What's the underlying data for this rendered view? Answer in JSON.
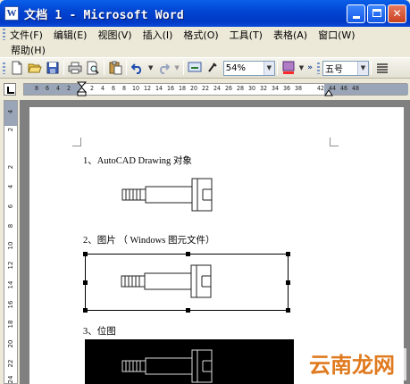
{
  "window": {
    "title": "文档 1 - Microsoft Word",
    "app_icon": "W",
    "controls": [
      "minimize-icon",
      "maximize-icon",
      "close-icon"
    ]
  },
  "menu": {
    "row1": [
      "文件(F)",
      "编辑(E)",
      "视图(V)",
      "插入(I)",
      "格式(O)",
      "工具(T)",
      "表格(A)",
      "窗口(W)"
    ],
    "row2": [
      "帮助(H)"
    ]
  },
  "toolbar": {
    "zoom": "54%",
    "font_size": "五号",
    "icons": [
      "new-icon",
      "open-icon",
      "save-icon",
      "print-icon",
      "print-preview-icon",
      "paste-icon",
      "undo-icon",
      "redo-icon",
      "insert-hyperlink-icon",
      "format-painter-icon",
      "highlight-icon",
      "align-icon"
    ]
  },
  "ruler": {
    "ticks": [
      "8",
      "6",
      "4",
      "2",
      "2",
      "4",
      "6",
      "8",
      "10",
      "12",
      "14",
      "16",
      "18",
      "20",
      "22",
      "24",
      "26",
      "28",
      "30",
      "32",
      "34",
      "36",
      "38",
      "42",
      "44",
      "46",
      "48"
    ],
    "vticks": [
      "4",
      "2",
      "2",
      "4",
      "6",
      "8",
      "10",
      "12",
      "14",
      "16",
      "18",
      "20",
      "22",
      "24"
    ]
  },
  "document": {
    "items": [
      {
        "label": "1、AutoCAD Drawing 对象"
      },
      {
        "label": "2、图片 （ Windows 图元文件）"
      },
      {
        "label": "3、位图"
      }
    ]
  },
  "watermark": {
    "text": "云南龙网",
    "color": "#e07a1f"
  }
}
